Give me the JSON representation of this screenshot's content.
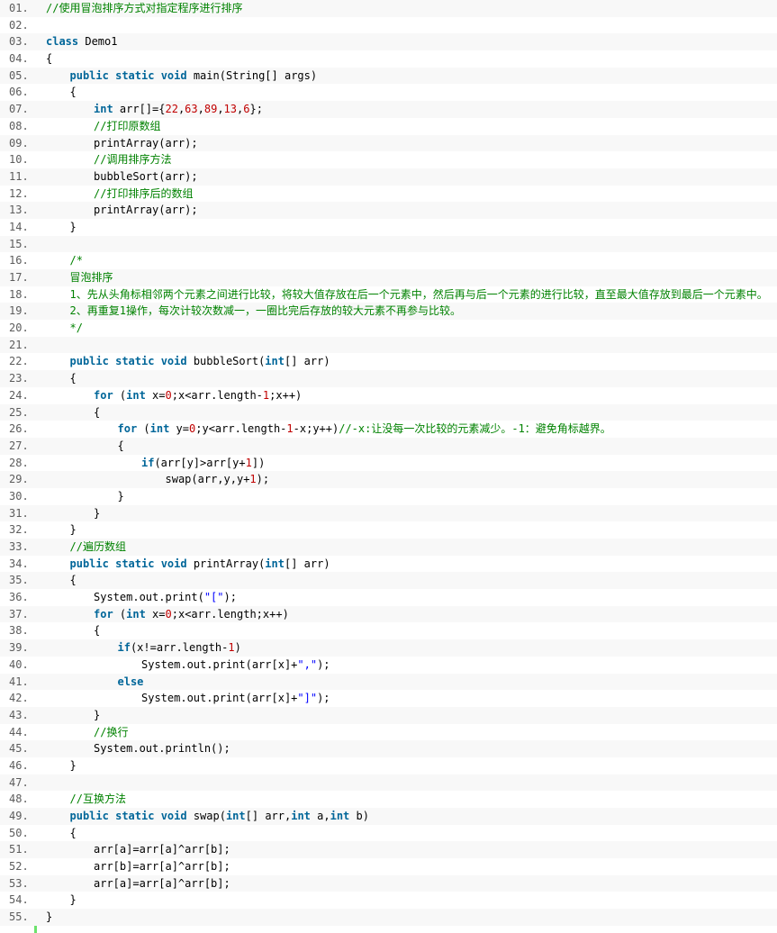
{
  "colors": {
    "keyword": "#006699",
    "comment": "#008200",
    "number": "#c00000",
    "string": "#0000ff",
    "gutter_bar": "#6ce26c",
    "line_number": "#5c5c5c"
  },
  "lines": [
    {
      "n": "01.",
      "indent": 0,
      "segs": [
        {
          "t": "//使用冒泡排序方式对指定程序进行排序",
          "c": "cm"
        }
      ]
    },
    {
      "n": "02.",
      "indent": 0,
      "segs": []
    },
    {
      "n": "03.",
      "indent": 0,
      "segs": [
        {
          "t": "class",
          "c": "kw"
        },
        {
          "t": " Demo1"
        }
      ]
    },
    {
      "n": "04.",
      "indent": 0,
      "segs": [
        {
          "t": "{"
        }
      ]
    },
    {
      "n": "05.",
      "indent": 1,
      "segs": [
        {
          "t": "public",
          "c": "kw"
        },
        {
          "t": " "
        },
        {
          "t": "static",
          "c": "kw"
        },
        {
          "t": " "
        },
        {
          "t": "void",
          "c": "kw"
        },
        {
          "t": " main(String[] args)"
        }
      ]
    },
    {
      "n": "06.",
      "indent": 1,
      "segs": [
        {
          "t": "{"
        }
      ]
    },
    {
      "n": "07.",
      "indent": 2,
      "segs": [
        {
          "t": "int",
          "c": "kw"
        },
        {
          "t": " arr[]={"
        },
        {
          "t": "22",
          "c": "num"
        },
        {
          "t": ","
        },
        {
          "t": "63",
          "c": "num"
        },
        {
          "t": ","
        },
        {
          "t": "89",
          "c": "num"
        },
        {
          "t": ","
        },
        {
          "t": "13",
          "c": "num"
        },
        {
          "t": ","
        },
        {
          "t": "6",
          "c": "num"
        },
        {
          "t": "};"
        }
      ]
    },
    {
      "n": "08.",
      "indent": 2,
      "segs": [
        {
          "t": "//打印原数组",
          "c": "cm"
        }
      ]
    },
    {
      "n": "09.",
      "indent": 2,
      "segs": [
        {
          "t": "printArray(arr);"
        }
      ]
    },
    {
      "n": "10.",
      "indent": 2,
      "segs": [
        {
          "t": "//调用排序方法",
          "c": "cm"
        }
      ]
    },
    {
      "n": "11.",
      "indent": 2,
      "segs": [
        {
          "t": "bubbleSort(arr);"
        }
      ]
    },
    {
      "n": "12.",
      "indent": 2,
      "segs": [
        {
          "t": "//打印排序后的数组",
          "c": "cm"
        }
      ]
    },
    {
      "n": "13.",
      "indent": 2,
      "segs": [
        {
          "t": "printArray(arr);"
        }
      ]
    },
    {
      "n": "14.",
      "indent": 1,
      "segs": [
        {
          "t": "}"
        }
      ]
    },
    {
      "n": "15.",
      "indent": 0,
      "segs": []
    },
    {
      "n": "16.",
      "indent": 1,
      "segs": [
        {
          "t": "/*",
          "c": "cm"
        }
      ]
    },
    {
      "n": "17.",
      "indent": 1,
      "segs": [
        {
          "t": "冒泡排序",
          "c": "cm"
        }
      ]
    },
    {
      "n": "18.",
      "indent": 1,
      "segs": [
        {
          "t": "1、先从头角标相邻两个元素之间进行比较，将较大值存放在后一个元素中，然后再与后一个元素的进行比较，直至最大值存放到最后一个元素中。",
          "c": "cm"
        }
      ]
    },
    {
      "n": "19.",
      "indent": 1,
      "segs": [
        {
          "t": "2、再重复1操作，每次计较次数减一，一圈比完后存放的较大元素不再参与比较。",
          "c": "cm"
        }
      ]
    },
    {
      "n": "20.",
      "indent": 1,
      "segs": [
        {
          "t": "*/",
          "c": "cm"
        }
      ]
    },
    {
      "n": "21.",
      "indent": 0,
      "segs": []
    },
    {
      "n": "22.",
      "indent": 1,
      "segs": [
        {
          "t": "public",
          "c": "kw"
        },
        {
          "t": " "
        },
        {
          "t": "static",
          "c": "kw"
        },
        {
          "t": " "
        },
        {
          "t": "void",
          "c": "kw"
        },
        {
          "t": " bubbleSort("
        },
        {
          "t": "int",
          "c": "kw"
        },
        {
          "t": "[] arr)"
        }
      ]
    },
    {
      "n": "23.",
      "indent": 1,
      "segs": [
        {
          "t": "{"
        }
      ]
    },
    {
      "n": "24.",
      "indent": 2,
      "segs": [
        {
          "t": "for",
          "c": "kw"
        },
        {
          "t": " ("
        },
        {
          "t": "int",
          "c": "kw"
        },
        {
          "t": " x="
        },
        {
          "t": "0",
          "c": "num"
        },
        {
          "t": ";x<arr.length-"
        },
        {
          "t": "1",
          "c": "num"
        },
        {
          "t": ";x++)"
        }
      ]
    },
    {
      "n": "25.",
      "indent": 2,
      "segs": [
        {
          "t": "{"
        }
      ]
    },
    {
      "n": "26.",
      "indent": 3,
      "segs": [
        {
          "t": "for",
          "c": "kw"
        },
        {
          "t": " ("
        },
        {
          "t": "int",
          "c": "kw"
        },
        {
          "t": " y="
        },
        {
          "t": "0",
          "c": "num"
        },
        {
          "t": ";y<arr.length-"
        },
        {
          "t": "1",
          "c": "num"
        },
        {
          "t": "-x;y++)"
        },
        {
          "t": "//-x:让没每一次比较的元素减少。-1：避免角标越界。",
          "c": "cm"
        }
      ]
    },
    {
      "n": "27.",
      "indent": 3,
      "segs": [
        {
          "t": "{"
        }
      ]
    },
    {
      "n": "28.",
      "indent": 4,
      "segs": [
        {
          "t": "if",
          "c": "kw"
        },
        {
          "t": "(arr[y]>arr[y+"
        },
        {
          "t": "1",
          "c": "num"
        },
        {
          "t": "])"
        }
      ]
    },
    {
      "n": "29.",
      "indent": 5,
      "segs": [
        {
          "t": "swap(arr,y,y+"
        },
        {
          "t": "1",
          "c": "num"
        },
        {
          "t": ");"
        }
      ]
    },
    {
      "n": "30.",
      "indent": 3,
      "segs": [
        {
          "t": "}"
        }
      ]
    },
    {
      "n": "31.",
      "indent": 2,
      "segs": [
        {
          "t": "}"
        }
      ]
    },
    {
      "n": "32.",
      "indent": 1,
      "segs": [
        {
          "t": "}"
        }
      ]
    },
    {
      "n": "33.",
      "indent": 1,
      "segs": [
        {
          "t": "//遍历数组",
          "c": "cm"
        }
      ]
    },
    {
      "n": "34.",
      "indent": 1,
      "segs": [
        {
          "t": "public",
          "c": "kw"
        },
        {
          "t": " "
        },
        {
          "t": "static",
          "c": "kw"
        },
        {
          "t": " "
        },
        {
          "t": "void",
          "c": "kw"
        },
        {
          "t": " printArray("
        },
        {
          "t": "int",
          "c": "kw"
        },
        {
          "t": "[] arr)"
        }
      ]
    },
    {
      "n": "35.",
      "indent": 1,
      "segs": [
        {
          "t": "{"
        }
      ]
    },
    {
      "n": "36.",
      "indent": 2,
      "segs": [
        {
          "t": "System.out.print("
        },
        {
          "t": "\"[\"",
          "c": "str"
        },
        {
          "t": ");"
        }
      ]
    },
    {
      "n": "37.",
      "indent": 2,
      "segs": [
        {
          "t": "for",
          "c": "kw"
        },
        {
          "t": " ("
        },
        {
          "t": "int",
          "c": "kw"
        },
        {
          "t": " x="
        },
        {
          "t": "0",
          "c": "num"
        },
        {
          "t": ";x<arr.length;x++)"
        }
      ]
    },
    {
      "n": "38.",
      "indent": 2,
      "segs": [
        {
          "t": "{"
        }
      ]
    },
    {
      "n": "39.",
      "indent": 3,
      "segs": [
        {
          "t": "if",
          "c": "kw"
        },
        {
          "t": "(x!=arr.length-"
        },
        {
          "t": "1",
          "c": "num"
        },
        {
          "t": ")"
        }
      ]
    },
    {
      "n": "40.",
      "indent": 4,
      "segs": [
        {
          "t": "System.out.print(arr[x]+"
        },
        {
          "t": "\",\"",
          "c": "str"
        },
        {
          "t": ");"
        }
      ]
    },
    {
      "n": "41.",
      "indent": 3,
      "segs": [
        {
          "t": "else",
          "c": "kw"
        }
      ]
    },
    {
      "n": "42.",
      "indent": 4,
      "segs": [
        {
          "t": "System.out.print(arr[x]+"
        },
        {
          "t": "\"]\"",
          "c": "str"
        },
        {
          "t": ");"
        }
      ]
    },
    {
      "n": "43.",
      "indent": 2,
      "segs": [
        {
          "t": "}"
        }
      ]
    },
    {
      "n": "44.",
      "indent": 2,
      "segs": [
        {
          "t": "//换行",
          "c": "cm"
        }
      ]
    },
    {
      "n": "45.",
      "indent": 2,
      "segs": [
        {
          "t": "System.out.println();"
        }
      ]
    },
    {
      "n": "46.",
      "indent": 1,
      "segs": [
        {
          "t": "}"
        }
      ]
    },
    {
      "n": "47.",
      "indent": 0,
      "segs": []
    },
    {
      "n": "48.",
      "indent": 1,
      "segs": [
        {
          "t": "//互换方法",
          "c": "cm"
        }
      ]
    },
    {
      "n": "49.",
      "indent": 1,
      "segs": [
        {
          "t": "public",
          "c": "kw"
        },
        {
          "t": " "
        },
        {
          "t": "static",
          "c": "kw"
        },
        {
          "t": " "
        },
        {
          "t": "void",
          "c": "kw"
        },
        {
          "t": " swap("
        },
        {
          "t": "int",
          "c": "kw"
        },
        {
          "t": "[] arr,"
        },
        {
          "t": "int",
          "c": "kw"
        },
        {
          "t": " a,"
        },
        {
          "t": "int",
          "c": "kw"
        },
        {
          "t": " b)"
        }
      ]
    },
    {
      "n": "50.",
      "indent": 1,
      "segs": [
        {
          "t": "{"
        }
      ]
    },
    {
      "n": "51.",
      "indent": 2,
      "segs": [
        {
          "t": "arr[a]=arr[a]^arr[b];"
        }
      ]
    },
    {
      "n": "52.",
      "indent": 2,
      "segs": [
        {
          "t": "arr[b]=arr[a]^arr[b];"
        }
      ]
    },
    {
      "n": "53.",
      "indent": 2,
      "segs": [
        {
          "t": "arr[a]=arr[a]^arr[b];"
        }
      ]
    },
    {
      "n": "54.",
      "indent": 1,
      "segs": [
        {
          "t": "}"
        }
      ]
    },
    {
      "n": "55.",
      "indent": 0,
      "segs": [
        {
          "t": "}"
        }
      ]
    }
  ]
}
